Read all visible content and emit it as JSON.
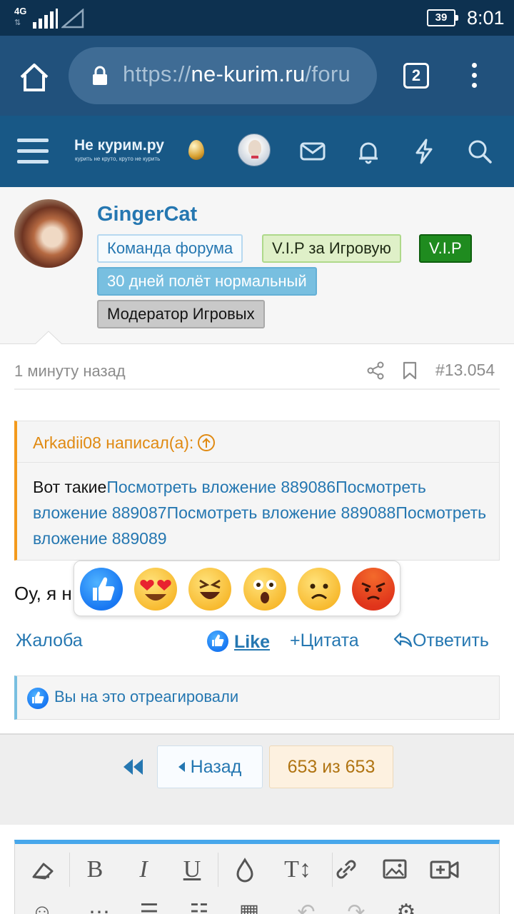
{
  "status_bar": {
    "network": "4G",
    "battery": "39",
    "time": "8:01"
  },
  "browser": {
    "url_scheme": "https://",
    "url_domain": "ne-kurim.ru",
    "url_path": "/foru",
    "tabs_count": "2"
  },
  "site": {
    "logo_title": "Не курим.ру",
    "logo_tagline": "курить не круто, круто не курить"
  },
  "profile": {
    "username": "GingerCat",
    "badges": [
      "Команда форума",
      "V.I.P за Игровую",
      "V.I.P",
      "30 дней полёт нормальный",
      "Модератор Игровых"
    ]
  },
  "post": {
    "time": "1 минуту назад",
    "number": "#13.054",
    "quote_author": "Arkadii08 написал(а):",
    "quote_prefix": "Вот такие",
    "quote_links": [
      "Посмотреть вложение 889086",
      "Посмотреть вложение 889087",
      "Посмотреть вложение 889088",
      "Посмотреть вложение 889089"
    ],
    "text_visible": "Оу, я н"
  },
  "reactions": [
    "like",
    "love",
    "haha",
    "wow",
    "sad",
    "angry"
  ],
  "actions": {
    "report": "Жалоба",
    "like": "Like",
    "quote": "Цитата",
    "reply": "Ответить"
  },
  "reacted_notice": "Вы на это отреагировали",
  "pagination": {
    "back": "Назад",
    "count": "653 из 653"
  },
  "editor_tools": [
    "eraser",
    "bold",
    "italic",
    "underline",
    "color",
    "text-size",
    "link",
    "image",
    "video"
  ],
  "editor_glyphs": {
    "bold": "B",
    "italic": "I",
    "underline": "U",
    "text_size": "T↕"
  },
  "colors": {
    "brand_dark": "#185886",
    "link": "#2577b1",
    "quote_accent": "#f39a1c",
    "vip_green": "#1f8b1f"
  }
}
